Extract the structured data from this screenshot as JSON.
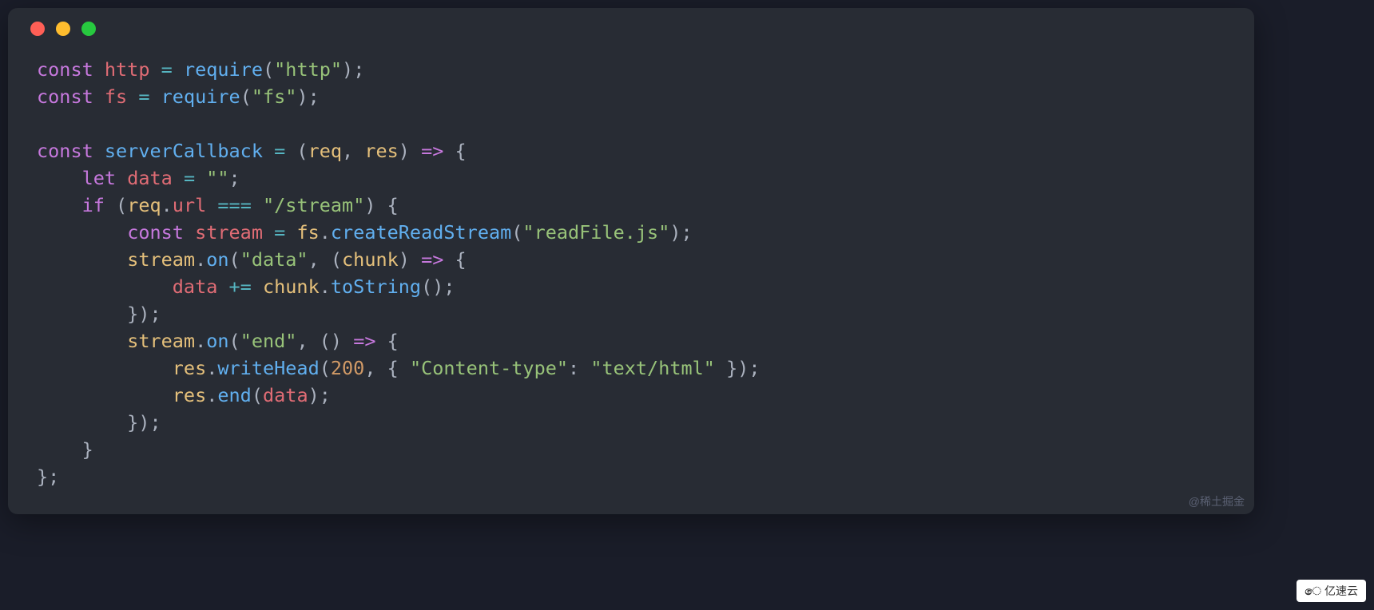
{
  "window": {
    "traffic_lights": [
      "red",
      "yellow",
      "green"
    ]
  },
  "code": {
    "lines": [
      [
        {
          "t": "const ",
          "c": "kw"
        },
        {
          "t": "http",
          "c": "var"
        },
        {
          "t": " ",
          "c": "plain"
        },
        {
          "t": "=",
          "c": "op"
        },
        {
          "t": " ",
          "c": "plain"
        },
        {
          "t": "require",
          "c": "fn"
        },
        {
          "t": "(",
          "c": "punc"
        },
        {
          "t": "\"http\"",
          "c": "str"
        },
        {
          "t": ");",
          "c": "punc"
        }
      ],
      [
        {
          "t": "const ",
          "c": "kw"
        },
        {
          "t": "fs",
          "c": "var"
        },
        {
          "t": " ",
          "c": "plain"
        },
        {
          "t": "=",
          "c": "op"
        },
        {
          "t": " ",
          "c": "plain"
        },
        {
          "t": "require",
          "c": "fn"
        },
        {
          "t": "(",
          "c": "punc"
        },
        {
          "t": "\"fs\"",
          "c": "str"
        },
        {
          "t": ");",
          "c": "punc"
        }
      ],
      [
        {
          "t": "",
          "c": "plain"
        }
      ],
      [
        {
          "t": "const ",
          "c": "kw"
        },
        {
          "t": "serverCallback",
          "c": "fn"
        },
        {
          "t": " ",
          "c": "plain"
        },
        {
          "t": "=",
          "c": "op"
        },
        {
          "t": " (",
          "c": "punc"
        },
        {
          "t": "req",
          "c": "ident"
        },
        {
          "t": ", ",
          "c": "punc"
        },
        {
          "t": "res",
          "c": "ident"
        },
        {
          "t": ") ",
          "c": "punc"
        },
        {
          "t": "=>",
          "c": "kw"
        },
        {
          "t": " {",
          "c": "punc"
        }
      ],
      [
        {
          "t": "    ",
          "c": "plain"
        },
        {
          "t": "let ",
          "c": "kw"
        },
        {
          "t": "data",
          "c": "var"
        },
        {
          "t": " ",
          "c": "plain"
        },
        {
          "t": "=",
          "c": "op"
        },
        {
          "t": " ",
          "c": "plain"
        },
        {
          "t": "\"\"",
          "c": "str"
        },
        {
          "t": ";",
          "c": "punc"
        }
      ],
      [
        {
          "t": "    ",
          "c": "plain"
        },
        {
          "t": "if",
          "c": "kw"
        },
        {
          "t": " (",
          "c": "punc"
        },
        {
          "t": "req",
          "c": "ident"
        },
        {
          "t": ".",
          "c": "punc"
        },
        {
          "t": "url",
          "c": "prop"
        },
        {
          "t": " ",
          "c": "plain"
        },
        {
          "t": "===",
          "c": "op"
        },
        {
          "t": " ",
          "c": "plain"
        },
        {
          "t": "\"/stream\"",
          "c": "str"
        },
        {
          "t": ") {",
          "c": "punc"
        }
      ],
      [
        {
          "t": "        ",
          "c": "plain"
        },
        {
          "t": "const ",
          "c": "kw"
        },
        {
          "t": "stream",
          "c": "var"
        },
        {
          "t": " ",
          "c": "plain"
        },
        {
          "t": "=",
          "c": "op"
        },
        {
          "t": " ",
          "c": "plain"
        },
        {
          "t": "fs",
          "c": "ident"
        },
        {
          "t": ".",
          "c": "punc"
        },
        {
          "t": "createReadStream",
          "c": "fn"
        },
        {
          "t": "(",
          "c": "punc"
        },
        {
          "t": "\"readFile.js\"",
          "c": "str"
        },
        {
          "t": ");",
          "c": "punc"
        }
      ],
      [
        {
          "t": "        ",
          "c": "plain"
        },
        {
          "t": "stream",
          "c": "ident"
        },
        {
          "t": ".",
          "c": "punc"
        },
        {
          "t": "on",
          "c": "fn"
        },
        {
          "t": "(",
          "c": "punc"
        },
        {
          "t": "\"data\"",
          "c": "str"
        },
        {
          "t": ", (",
          "c": "punc"
        },
        {
          "t": "chunk",
          "c": "ident"
        },
        {
          "t": ") ",
          "c": "punc"
        },
        {
          "t": "=>",
          "c": "kw"
        },
        {
          "t": " {",
          "c": "punc"
        }
      ],
      [
        {
          "t": "            ",
          "c": "plain"
        },
        {
          "t": "data",
          "c": "var"
        },
        {
          "t": " ",
          "c": "plain"
        },
        {
          "t": "+=",
          "c": "op"
        },
        {
          "t": " ",
          "c": "plain"
        },
        {
          "t": "chunk",
          "c": "ident"
        },
        {
          "t": ".",
          "c": "punc"
        },
        {
          "t": "toString",
          "c": "fn"
        },
        {
          "t": "();",
          "c": "punc"
        }
      ],
      [
        {
          "t": "        });",
          "c": "punc"
        }
      ],
      [
        {
          "t": "        ",
          "c": "plain"
        },
        {
          "t": "stream",
          "c": "ident"
        },
        {
          "t": ".",
          "c": "punc"
        },
        {
          "t": "on",
          "c": "fn"
        },
        {
          "t": "(",
          "c": "punc"
        },
        {
          "t": "\"end\"",
          "c": "str"
        },
        {
          "t": ", () ",
          "c": "punc"
        },
        {
          "t": "=>",
          "c": "kw"
        },
        {
          "t": " {",
          "c": "punc"
        }
      ],
      [
        {
          "t": "            ",
          "c": "plain"
        },
        {
          "t": "res",
          "c": "ident"
        },
        {
          "t": ".",
          "c": "punc"
        },
        {
          "t": "writeHead",
          "c": "fn"
        },
        {
          "t": "(",
          "c": "punc"
        },
        {
          "t": "200",
          "c": "num"
        },
        {
          "t": ", { ",
          "c": "punc"
        },
        {
          "t": "\"Content-type\"",
          "c": "str"
        },
        {
          "t": ": ",
          "c": "punc"
        },
        {
          "t": "\"text/html\"",
          "c": "str"
        },
        {
          "t": " });",
          "c": "punc"
        }
      ],
      [
        {
          "t": "            ",
          "c": "plain"
        },
        {
          "t": "res",
          "c": "ident"
        },
        {
          "t": ".",
          "c": "punc"
        },
        {
          "t": "end",
          "c": "fn"
        },
        {
          "t": "(",
          "c": "punc"
        },
        {
          "t": "data",
          "c": "var"
        },
        {
          "t": ");",
          "c": "punc"
        }
      ],
      [
        {
          "t": "        });",
          "c": "punc"
        }
      ],
      [
        {
          "t": "    }",
          "c": "punc"
        }
      ],
      [
        {
          "t": "};",
          "c": "punc"
        }
      ]
    ]
  },
  "watermark": "@稀土掘金",
  "badge": {
    "icon": "ෙ",
    "text": "亿速云"
  }
}
